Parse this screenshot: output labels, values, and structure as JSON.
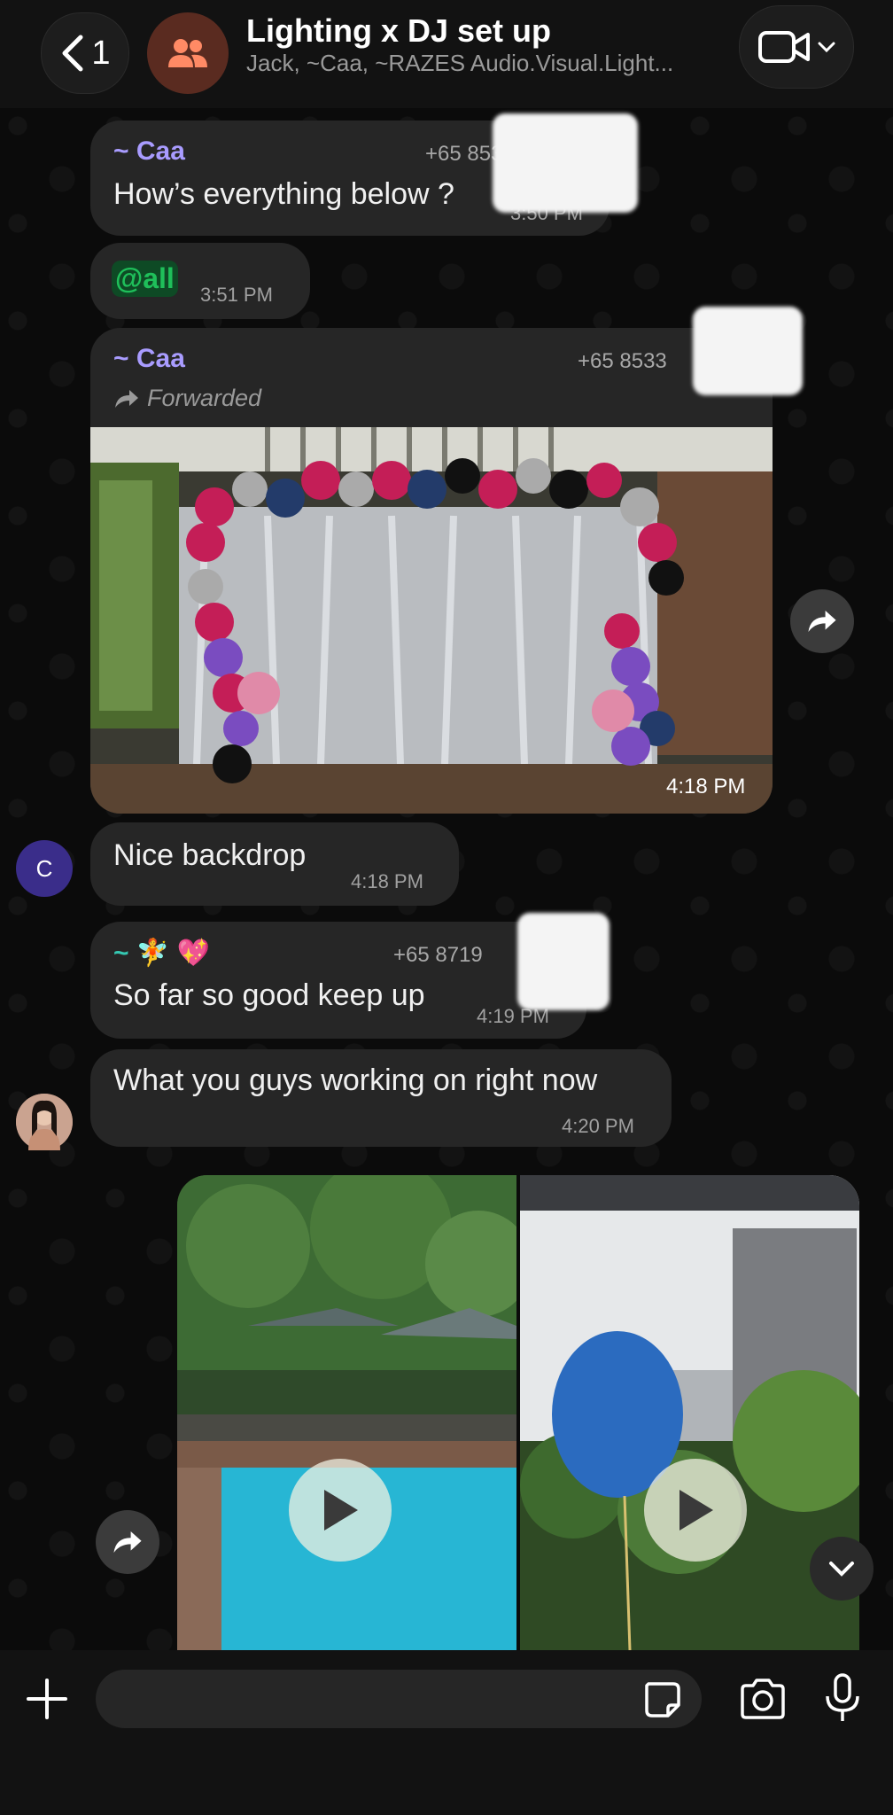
{
  "header": {
    "back_count": "1",
    "title": "Lighting x DJ set up",
    "subtitle": "Jack, ~Caa, ~RAZES Audio.Visual.Light..."
  },
  "messages": [
    {
      "sender": "~ Caa",
      "phone": "+65 853",
      "text": "How’s everything below ?",
      "time": "3:50 PM"
    },
    {
      "mention": "@all",
      "time": "3:51 PM"
    },
    {
      "sender": "~ Caa",
      "phone": "+65 8533",
      "forwarded": "Forwarded",
      "time": "4:18 PM"
    },
    {
      "avatar_letter": "C",
      "text": "Nice backdrop",
      "time": "4:18 PM"
    },
    {
      "sender": "~ 🧚 💖",
      "phone": "+65 8719",
      "text": "So far so good keep up",
      "time": "4:19 PM"
    },
    {
      "text": "What you guys working on right now",
      "time": "4:20 PM"
    }
  ],
  "colors": {
    "accent_sender": "#a99cff",
    "mention_green": "#1fbf5a",
    "sender_teal": "#35c8b2",
    "avatar_purple": "#3a2d8a",
    "group_avatar_icon": "#ff8a65"
  }
}
